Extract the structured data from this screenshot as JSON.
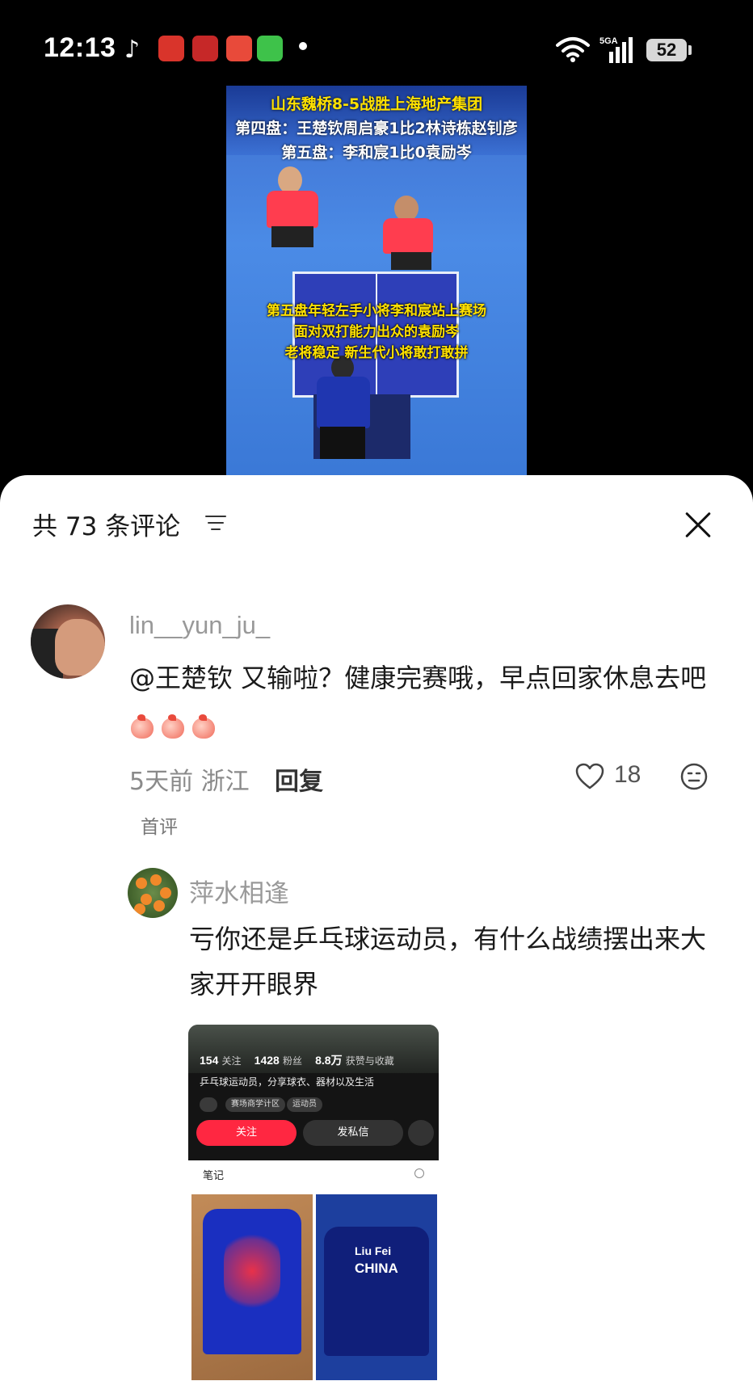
{
  "status_bar": {
    "time": "12:13",
    "battery": "52",
    "network": "5GA"
  },
  "video": {
    "banner_line1": "山东魏桥8-5战胜上海地产集团",
    "banner_line2": "第四盘：王楚钦周启豪1比2林诗栋赵钊彦",
    "banner_line3": "第五盘：李和宸1比0袁励岑",
    "caption_line1": "第五盘年轻左手小将李和宸站上赛场",
    "caption_line2": "面对双打能力出众的袁励岑",
    "caption_line3": "老将稳定 新生代小将敢打敢拼"
  },
  "comments_panel": {
    "title": "共 73 条评论",
    "sort_icon": "filter-lines-icon",
    "close_icon": "close-x-icon"
  },
  "comment1": {
    "username": "lin__yun_ju_",
    "text": "@王楚钦  又输啦？健康完赛哦，早点回家休息去吧",
    "emoji": "peach-emoji",
    "emoji_count": 3,
    "time_location": "5天前 浙江",
    "reply_label": "回复",
    "likes": "18",
    "tag": "首评"
  },
  "comment2": {
    "username": "萍水相逢",
    "text": "亏你还是乒乓球运动员，有什么战绩摆出来大家开开眼界"
  },
  "attachment": {
    "stat_follow_num": "154",
    "stat_follow_label": "关注",
    "stat_fans_num": "1428",
    "stat_fans_label": "粉丝",
    "stat_likes_num": "8.8万",
    "stat_likes_label": "获赞与收藏",
    "bio": "乒乓球运动员，分享球衣、器材以及生活",
    "chip1": "",
    "chip2": "赛场商学计区",
    "chip3": "运动员",
    "follow_btn": "关注",
    "message_btn": "发私信",
    "notes_label": "笔记",
    "jersey_name": "Liu Fei",
    "jersey_country": "CHINA"
  },
  "colors": {
    "accent_red": "#ff2741",
    "text_primary": "#1a1a1a",
    "text_secondary": "#999999"
  }
}
